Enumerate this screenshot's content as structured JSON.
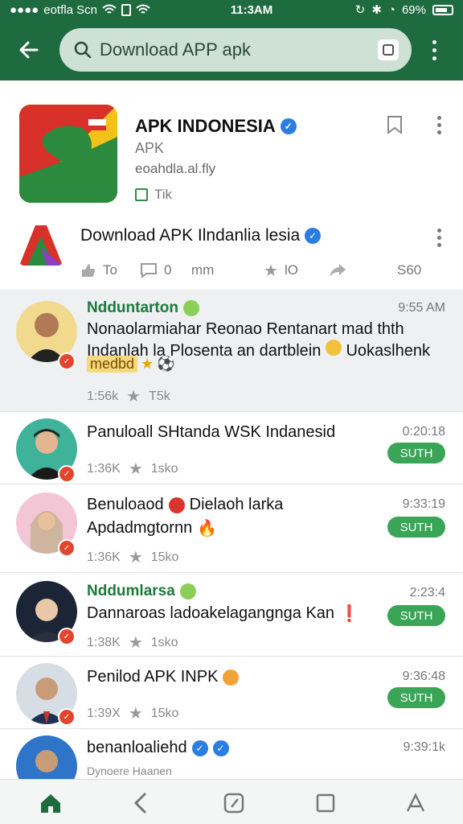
{
  "status_bar": {
    "carrier": "eotfla Scn",
    "time": "11:3AM",
    "battery": "69%"
  },
  "search": {
    "text": "Download APP apk"
  },
  "app": {
    "title": "APK INDONESIA",
    "subtitle": "APK",
    "developer": "eoahdla.al.fly",
    "tag": "Tik"
  },
  "post": {
    "title": "Download APK Ilndanlia lesia",
    "actions": {
      "like": "To",
      "comment": "0",
      "views": "mm",
      "stars": "lO",
      "share_count": "S60"
    }
  },
  "threads": [
    {
      "name": "Ndduntarton",
      "time": "9:55 AM",
      "body": "Nonaolarmiahar Reonao Rentanart mad thth Indanlah la Plosenta an dartblein",
      "body_end": "Uokaslhenk",
      "tag": "medbd",
      "likes": "1:56k",
      "stars": "T5k"
    },
    {
      "title": "Panuloall SHtanda WSK Indanesid",
      "time": "0:20:18",
      "button": "SUTH",
      "likes": "1:36K",
      "stars": "1sko"
    },
    {
      "title": "Benuloaod",
      "title_end": "Dielaoh larka",
      "line2": "Apdadmgtornn",
      "time": "9:33:19",
      "button": "SUTH",
      "likes": "1:36K",
      "stars": "15ko"
    },
    {
      "name": "Nddumlarsa",
      "line2": "Dannaroas ladoakelagangnga Kan",
      "time": "2:23:4",
      "button": "SUTH",
      "likes": "1:38K",
      "stars": "1sko"
    },
    {
      "title": "Penilod APK INPK",
      "time": "9:36:48",
      "button": "SUTH",
      "likes": "1:39X",
      "stars": "15ko"
    },
    {
      "title": "benanloaliehd",
      "time": "9:39:1k",
      "line2": "Dynoere Haanen"
    }
  ],
  "colors": {
    "primary": "#1e6b3f",
    "accent_green": "#3aa556",
    "verified_blue": "#2b7de0",
    "badge_red": "#e2462e"
  }
}
